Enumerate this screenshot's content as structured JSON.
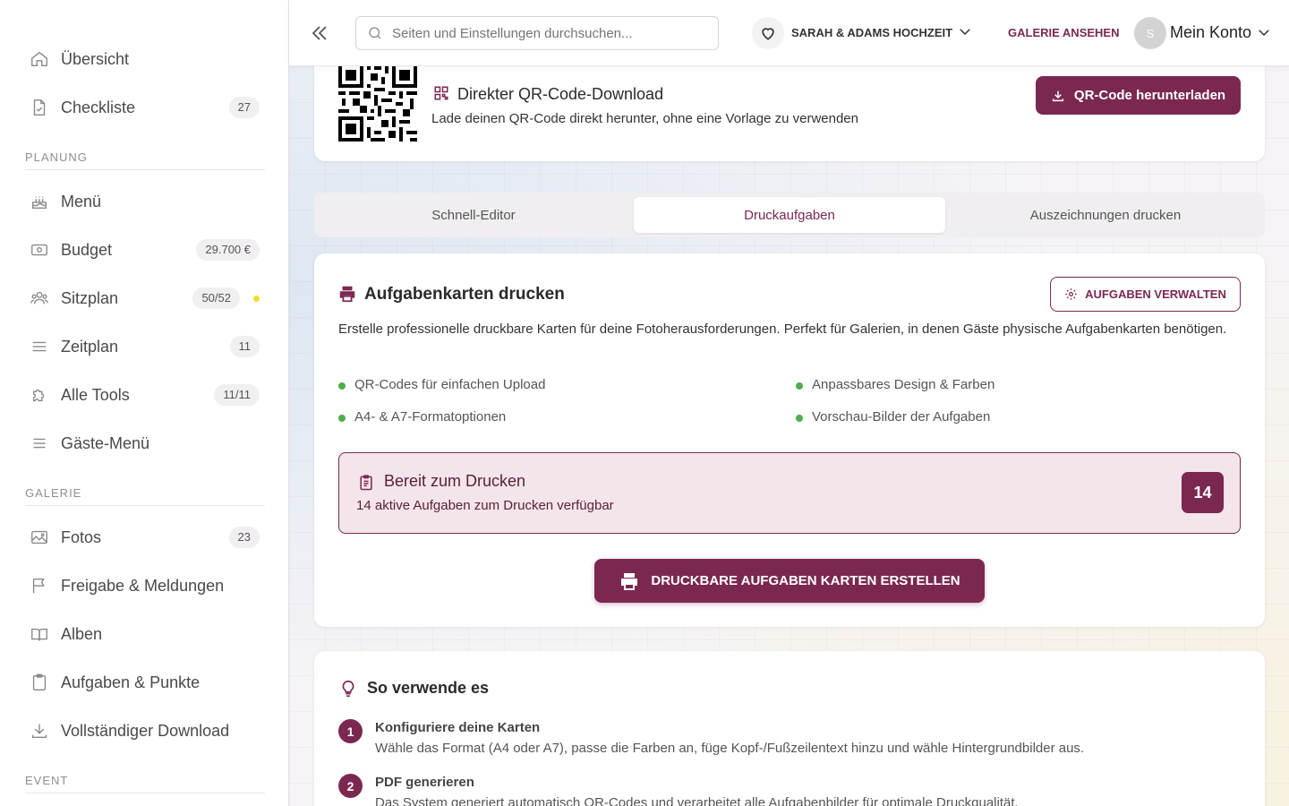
{
  "sidebar": {
    "items": [
      {
        "label": "Übersicht",
        "icon": "home-icon"
      },
      {
        "label": "Checkliste",
        "icon": "document-check-icon",
        "badge": "27"
      }
    ],
    "sections": [
      {
        "title": "PLANUNG",
        "items": [
          {
            "label": "Menü",
            "icon": "cake-icon"
          },
          {
            "label": "Budget",
            "icon": "banknote-icon",
            "badge": "29.700 €"
          },
          {
            "label": "Sitzplan",
            "icon": "users-icon",
            "badge": "50/52"
          },
          {
            "label": "Zeitplan",
            "icon": "list-icon",
            "badge": "11"
          },
          {
            "label": "Alle Tools",
            "icon": "puzzle-icon",
            "badge": "11/11"
          },
          {
            "label": "Gäste-Menü",
            "icon": "menu-icon"
          }
        ]
      },
      {
        "title": "GALERIE",
        "items": [
          {
            "label": "Fotos",
            "icon": "photo-icon",
            "badge": "23"
          },
          {
            "label": "Freigabe & Meldungen",
            "icon": "flag-icon"
          },
          {
            "label": "Alben",
            "icon": "book-icon"
          },
          {
            "label": "Aufgaben & Punkte",
            "icon": "clipboard-icon"
          },
          {
            "label": "Vollständiger Download",
            "icon": "download-icon"
          }
        ]
      },
      {
        "title": "EVENT",
        "items": []
      }
    ],
    "status_dot_color": "#f2dd33"
  },
  "header": {
    "search_placeholder": "Seiten und Einstellungen durchsuchen...",
    "event_name": "SARAH & ADAMS HOCHZEIT",
    "gallery_link": "GALERIE ANSEHEN",
    "avatar_initial": "S",
    "account_label": "Mein Konto"
  },
  "qr_card": {
    "title": "Direkter QR-Code-Download",
    "description": "Lade deinen QR-Code direkt herunter, ohne eine Vorlage zu verwenden",
    "button": "QR-Code herunterladen"
  },
  "tabs": [
    {
      "label": "Schnell-Editor",
      "active": false
    },
    {
      "label": "Druckaufgaben",
      "active": true
    },
    {
      "label": "Auszeichnungen drucken",
      "active": false
    }
  ],
  "print_card": {
    "title": "Aufgabenkarten drucken",
    "manage_button": "AUFGABEN VERWALTEN",
    "description": "Erstelle professionelle druckbare Karten für deine Fotoherausforderungen. Perfekt für Galerien, in denen Gäste physische Aufgabenkarten benötigen.",
    "features": [
      "QR-Codes für einfachen Upload",
      "Anpassbares Design & Farben",
      "A4- & A7-Formatoptionen",
      "Vorschau-Bilder der Aufgaben"
    ],
    "ready": {
      "title": "Bereit zum Drucken",
      "subtitle": "14 aktive Aufgaben zum Drucken verfügbar",
      "count": "14"
    },
    "create_button": "DRUCKBARE AUFGABEN KARTEN ERSTELLEN"
  },
  "howto": {
    "title": "So verwende es",
    "steps": [
      {
        "number": "1",
        "title": "Konfiguriere deine Karten",
        "text": "Wähle das Format (A4 oder A7), passe die Farben an, füge Kopf-/Fußzeilentext hinzu und wähle Hintergrundbilder aus."
      },
      {
        "number": "2",
        "title": "PDF generieren",
        "text": "Das System generiert automatisch QR-Codes und verarbeitet alle Aufgabenbilder für optimale Druckqualität."
      }
    ]
  },
  "colors": {
    "brand": "#7b2850",
    "feature_bullet": "#4caf50",
    "ready_bg": "#f3e5ea"
  }
}
